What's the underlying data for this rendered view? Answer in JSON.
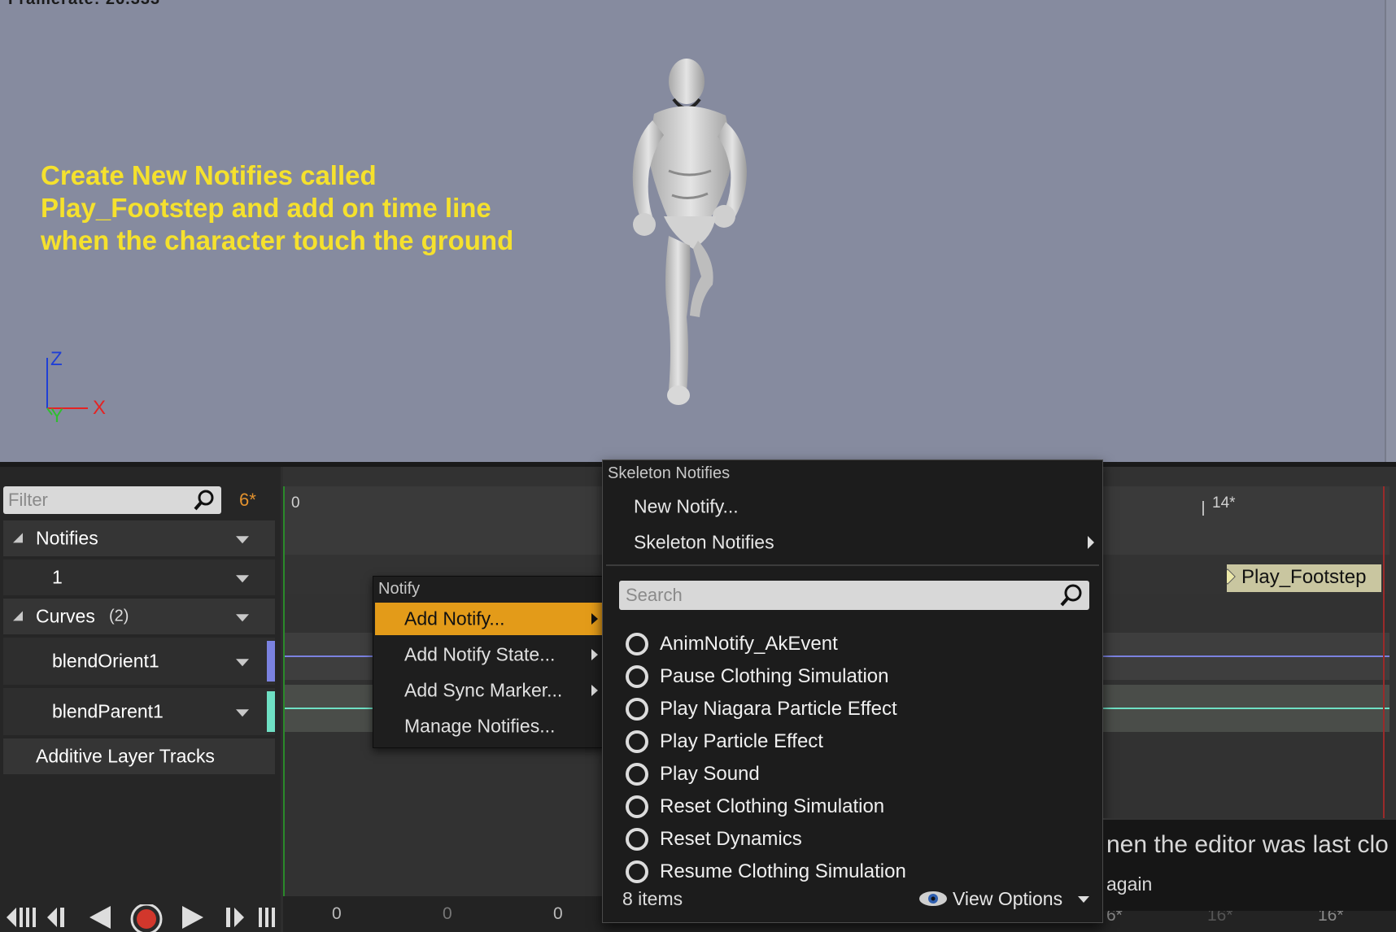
{
  "viewport": {
    "framerate": "Framerate: 26.333",
    "instruction_lines": [
      "Create New Notifies called",
      "Play_Footstep and add on time line",
      "when the character touch the ground"
    ],
    "axis": {
      "z": "Z",
      "y": "Y",
      "x": "X"
    },
    "colors": {
      "background": "#868b9f",
      "instruction": "#f5e12d",
      "axis_z": "#1f3fd6",
      "axis_y": "#2fbf2f",
      "axis_x": "#e52323"
    }
  },
  "left_panel": {
    "filter_placeholder": "Filter",
    "frame_count": "6*",
    "tracks": [
      {
        "label": "Notifies"
      },
      {
        "label": "1"
      },
      {
        "label": "Curves",
        "count": "(2)"
      },
      {
        "label": "blendOrient1",
        "color": "#7b82e0"
      },
      {
        "label": "blendParent1",
        "color": "#6fe0c4"
      },
      {
        "label": "Additive Layer Tracks"
      }
    ]
  },
  "timeline": {
    "ruler_start": "0",
    "ruler_mark": "14*",
    "notify_marker": "Play_Footstep",
    "bottom_values": [
      "0",
      "0",
      "0",
      "6*",
      "16*",
      "16*"
    ]
  },
  "context_menu": {
    "header": "Notify",
    "items": [
      {
        "label": "Add Notify...",
        "has_submenu": true,
        "active": true
      },
      {
        "label": "Add Notify State...",
        "has_submenu": true
      },
      {
        "label": "Add Sync Marker...",
        "has_submenu": true
      },
      {
        "label": "Manage Notifies...",
        "has_submenu": false
      }
    ]
  },
  "submenu": {
    "header": "Skeleton Notifies",
    "items": [
      {
        "label": "New Notify..."
      },
      {
        "label": "Skeleton Notifies",
        "has_submenu": true
      }
    ],
    "search_placeholder": "Search",
    "options": [
      "AnimNotify_AkEvent",
      "Pause Clothing Simulation",
      "Play Niagara Particle Effect",
      "Play Particle Effect",
      "Play Sound",
      "Reset Clothing Simulation",
      "Reset Dynamics",
      "Resume Clothing Simulation"
    ],
    "item_count": "8 items",
    "view_options": "View Options"
  },
  "toast": {
    "line1": "nen the editor was last clo",
    "line2": "again"
  },
  "icons": [
    "search-icon",
    "dropdown-arrow-icon",
    "submenu-arrow-icon",
    "eye-icon",
    "radio-icon",
    "go-to-start-icon",
    "step-back-icon",
    "play-reverse-icon",
    "record-icon",
    "play-icon",
    "step-forward-icon",
    "go-to-end-icon"
  ]
}
